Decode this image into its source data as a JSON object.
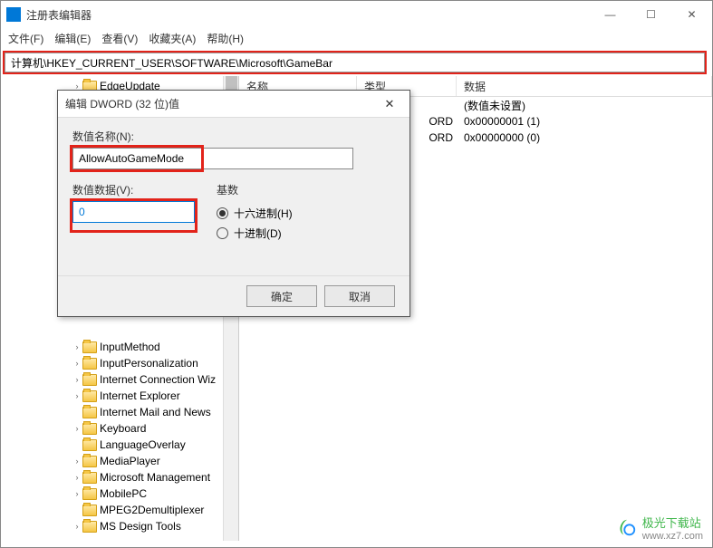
{
  "window": {
    "title": "注册表编辑器",
    "controls": {
      "min": "—",
      "max": "☐",
      "close": "✕"
    }
  },
  "menu": [
    "文件(F)",
    "编辑(E)",
    "查看(V)",
    "收藏夹(A)",
    "帮助(H)"
  ],
  "address": "计算机\\HKEY_CURRENT_USER\\SOFTWARE\\Microsoft\\GameBar",
  "tree": [
    "EdgeUpdate",
    "InputMethod",
    "InputPersonalization",
    "Internet Connection Wiz",
    "Internet Explorer",
    "Internet Mail and News",
    "Keyboard",
    "LanguageOverlay",
    "MediaPlayer",
    "Microsoft Management",
    "MobilePC",
    "MPEG2Demultiplexer",
    "MS Design Tools"
  ],
  "list": {
    "headers": {
      "name": "名称",
      "type": "类型",
      "data": "数据"
    },
    "rows": [
      {
        "data": "(数值未设置)"
      },
      {
        "typeSuffix": "ORD",
        "data": "0x00000001 (1)"
      },
      {
        "typeSuffix": "ORD",
        "data": "0x00000000 (0)"
      }
    ]
  },
  "dialog": {
    "title": "编辑 DWORD (32 位)值",
    "nameLabel": "数值名称(N):",
    "nameValue": "AllowAutoGameMode",
    "valueLabel": "数值数据(V):",
    "valueValue": "0",
    "baseLabel": "基数",
    "radioHex": "十六进制(H)",
    "radioDec": "十进制(D)",
    "ok": "确定",
    "cancel": "取消",
    "close": "✕"
  },
  "watermark": {
    "text": "极光下载站",
    "url": "www.xz7.com"
  }
}
